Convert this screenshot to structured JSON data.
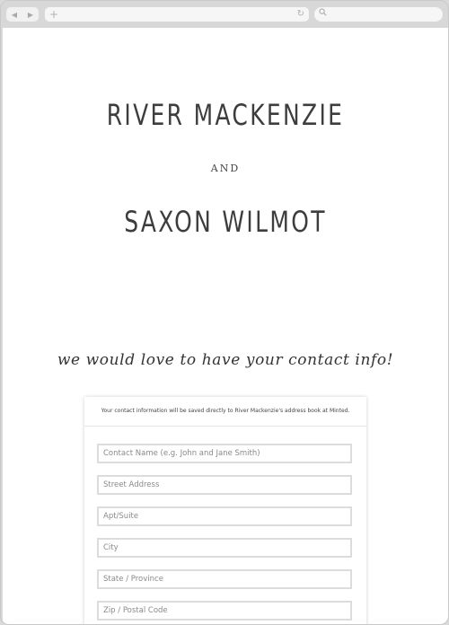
{
  "browser": {
    "back_icon": "back-arrow-icon",
    "forward_icon": "forward-arrow-icon",
    "new_tab_icon": "plus-icon",
    "reload_icon": "reload-icon",
    "search_icon": "search-icon"
  },
  "invitation": {
    "name_one": "RIVER MACKENZIE",
    "connector": "AND",
    "name_two": "SAXON WILMOT",
    "tagline": "we would love to have your contact info!"
  },
  "form": {
    "note": "Your contact information will be saved directly to River Mackenzie's address book at Minted.",
    "fields": [
      {
        "placeholder": "Contact Name (e.g. John and Jane Smith)"
      },
      {
        "placeholder": "Street Address"
      },
      {
        "placeholder": "Apt/Suite"
      },
      {
        "placeholder": "City"
      },
      {
        "placeholder": "State / Province"
      },
      {
        "placeholder": "Zip / Postal Code"
      }
    ]
  }
}
